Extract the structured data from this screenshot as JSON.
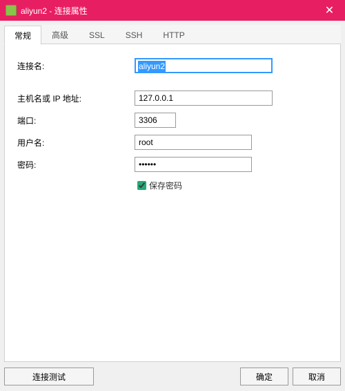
{
  "window": {
    "title": "aliyun2 - 连接属性",
    "close_glyph": "✕"
  },
  "tabs": {
    "general": "常规",
    "advanced": "高级",
    "ssl": "SSL",
    "ssh": "SSH",
    "http": "HTTP"
  },
  "form": {
    "name_label": "连接名:",
    "name_value": "aliyun2",
    "host_label": "主机名或 IP 地址:",
    "host_value": "127.0.0.1",
    "port_label": "端口:",
    "port_value": "3306",
    "user_label": "用户名:",
    "user_value": "root",
    "pass_label": "密码:",
    "pass_value": "••••••",
    "savepass_label": "保存密码"
  },
  "buttons": {
    "test": "连接测试",
    "ok": "确定",
    "cancel": "取消"
  }
}
